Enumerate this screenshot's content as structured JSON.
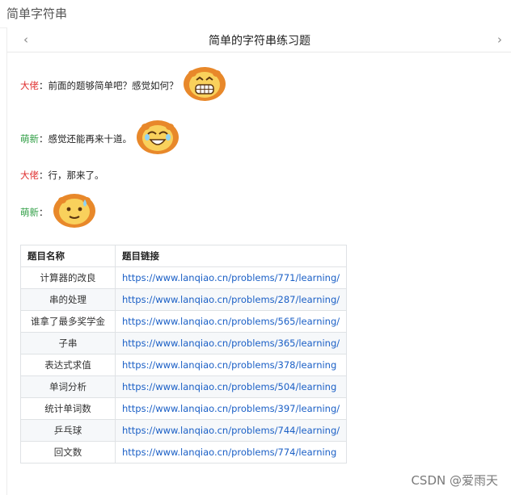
{
  "header": {
    "title": "简单字符串"
  },
  "nav": {
    "title": "简单的字符串练习题",
    "prev_glyph": "‹",
    "next_glyph": "›"
  },
  "dialogue": [
    {
      "speaker": "大佬",
      "sep": "：",
      "text": "前面的题够简单吧？感觉如何？",
      "emoji": "lion-grin-icon"
    },
    {
      "speaker": "萌新",
      "sep": "：",
      "text": "感觉还能再来十道。",
      "emoji": "lion-laugh-icon"
    },
    {
      "speaker": "大佬",
      "sep": "：",
      "text": "行，那来了。",
      "emoji": ""
    },
    {
      "speaker": "萌新",
      "sep": "：",
      "text": "",
      "emoji": "lion-sweat-icon"
    }
  ],
  "table": {
    "headers": [
      "题目名称",
      "题目链接"
    ],
    "rows": [
      {
        "name": "计算器的改良",
        "link": "https://www.lanqiao.cn/problems/771/learning/"
      },
      {
        "name": "串的处理",
        "link": "https://www.lanqiao.cn/problems/287/learning/"
      },
      {
        "name": "谁拿了最多奖学金",
        "link": "https://www.lanqiao.cn/problems/565/learning/"
      },
      {
        "name": "子串",
        "link": "https://www.lanqiao.cn/problems/365/learning/"
      },
      {
        "name": "表达式求值",
        "link": "https://www.lanqiao.cn/problems/378/learning"
      },
      {
        "name": "单词分析",
        "link": "https://www.lanqiao.cn/problems/504/learning"
      },
      {
        "name": "统计单词数",
        "link": "https://www.lanqiao.cn/problems/397/learning/"
      },
      {
        "name": "乒乓球",
        "link": "https://www.lanqiao.cn/problems/744/learning/"
      },
      {
        "name": "回文数",
        "link": "https://www.lanqiao.cn/problems/774/learning"
      }
    ]
  },
  "watermark": "CSDN @爱雨天",
  "colors": {
    "boss": "#e03131",
    "newbie": "#2f9e44",
    "link": "#1a5fc6"
  }
}
